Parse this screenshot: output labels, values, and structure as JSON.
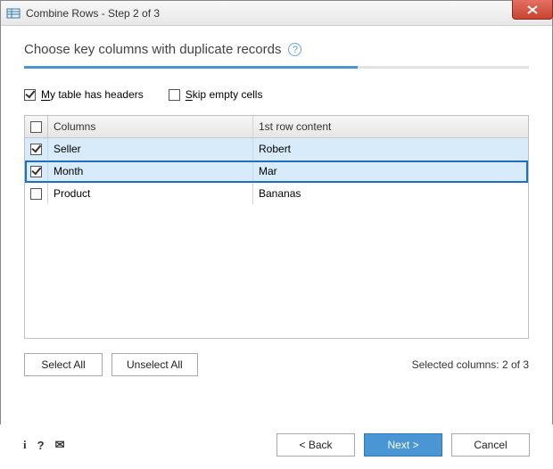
{
  "window": {
    "title": "Combine Rows - Step 2 of 3"
  },
  "header": {
    "text": "Choose key columns with duplicate records"
  },
  "options": {
    "has_headers": {
      "label_prefix": "M",
      "label_rest": "y table has headers",
      "checked": true
    },
    "skip_empty": {
      "label_prefix": "S",
      "label_rest": "kip empty cells",
      "checked": false
    }
  },
  "table": {
    "head": {
      "col_columns": "Columns",
      "col_firstrow": "1st row content"
    },
    "rows": [
      {
        "name": "Seller",
        "first": "Robert",
        "checked": true,
        "selected": true,
        "boxed": false
      },
      {
        "name": "Month",
        "first": "Mar",
        "checked": true,
        "selected": true,
        "boxed": true
      },
      {
        "name": "Product",
        "first": "Bananas",
        "checked": false,
        "selected": false,
        "boxed": false
      }
    ]
  },
  "actions": {
    "select_all": "Select All",
    "unselect_all": "Unselect All",
    "status": "Selected columns: 2 of 3"
  },
  "footer": {
    "back": "< Back",
    "next": "Next >",
    "cancel": "Cancel"
  }
}
